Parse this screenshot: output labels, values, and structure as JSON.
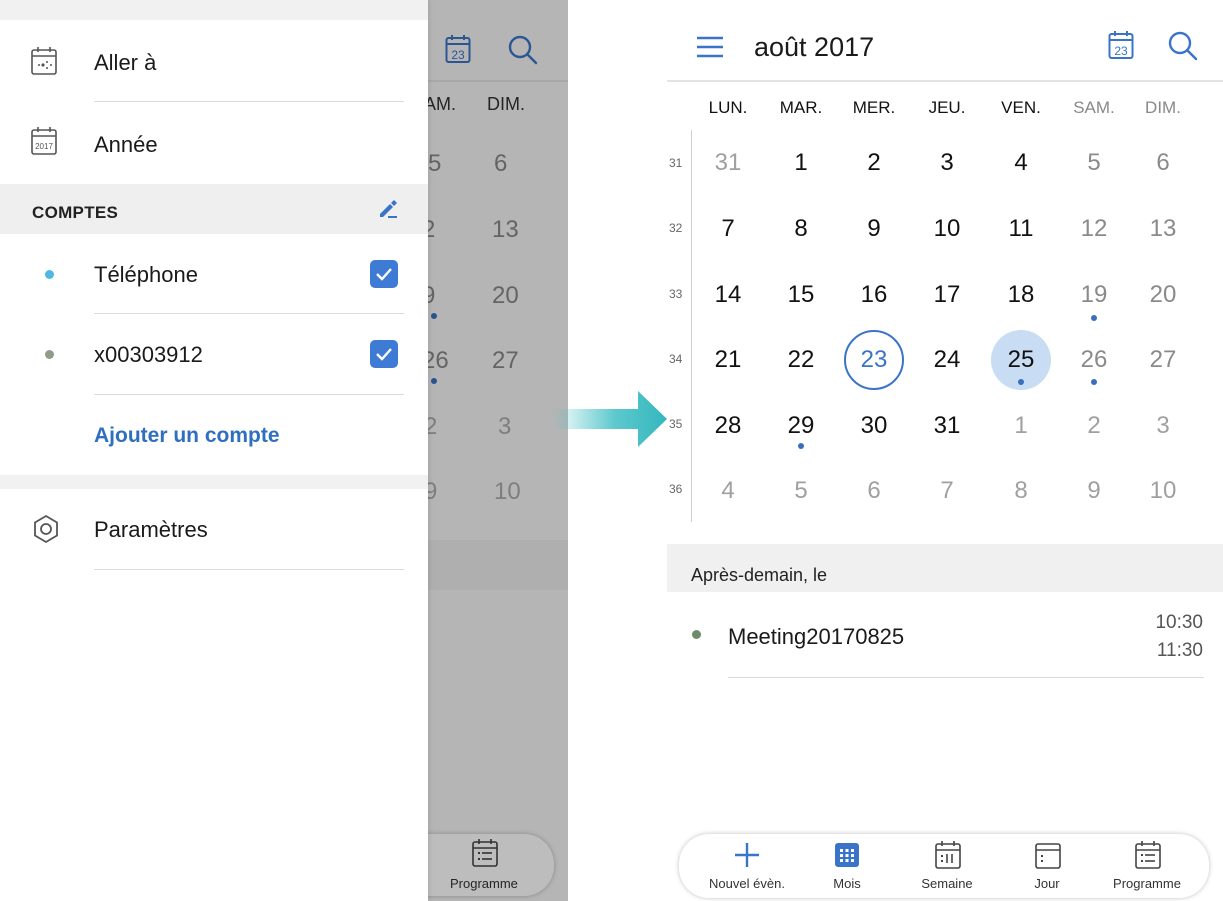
{
  "left": {
    "menu": {
      "goto": "Aller à",
      "year": "Année",
      "year_icon_text": "2017",
      "accounts_header": "COMPTES",
      "accounts": [
        {
          "name": "Téléphone",
          "color": "#4fb8e0",
          "checked": true
        },
        {
          "name": "x00303912",
          "color": "#8e9c88",
          "checked": true
        }
      ],
      "add_account": "Ajouter un compte",
      "settings": "Paramètres"
    },
    "background_calendar": {
      "today_icon_text": "23",
      "weekday_headers": [
        "AM.",
        "DIM."
      ],
      "rows": [
        [
          "5",
          "6"
        ],
        [
          "2",
          "13"
        ],
        [
          "9",
          "20"
        ],
        [
          "26",
          "27"
        ],
        [
          "2",
          "3"
        ],
        [
          "9",
          "10"
        ]
      ],
      "bottom_label": "Programme"
    }
  },
  "right": {
    "header": {
      "month": "août 2017",
      "today_icon_text": "23"
    },
    "weekdays": [
      "LUN.",
      "MAR.",
      "MER.",
      "JEU.",
      "VEN.",
      "SAM.",
      "DIM."
    ],
    "weeks": [
      {
        "no": "31",
        "days": [
          "31",
          "1",
          "2",
          "3",
          "4",
          "5",
          "6"
        ]
      },
      {
        "no": "32",
        "days": [
          "7",
          "8",
          "9",
          "10",
          "11",
          "12",
          "13"
        ]
      },
      {
        "no": "33",
        "days": [
          "14",
          "15",
          "16",
          "17",
          "18",
          "19",
          "20"
        ]
      },
      {
        "no": "34",
        "days": [
          "21",
          "22",
          "23",
          "24",
          "25",
          "26",
          "27"
        ]
      },
      {
        "no": "35",
        "days": [
          "28",
          "29",
          "30",
          "31",
          "1",
          "2",
          "3"
        ]
      },
      {
        "no": "36",
        "days": [
          "4",
          "5",
          "6",
          "7",
          "8",
          "9",
          "10"
        ]
      }
    ],
    "today": "23",
    "selected": "25",
    "agenda": {
      "title": "Après-demain, le",
      "event": {
        "name": "Meeting20170825",
        "start": "10:30",
        "end": "11:30",
        "color": "#6e8c6a"
      }
    },
    "bottom_nav": [
      {
        "label": "Nouvel évèn.",
        "icon": "plus-icon"
      },
      {
        "label": "Mois",
        "icon": "month-icon"
      },
      {
        "label": "Semaine",
        "icon": "week-icon"
      },
      {
        "label": "Jour",
        "icon": "day-icon"
      },
      {
        "label": "Programme",
        "icon": "agenda-icon"
      }
    ]
  },
  "colors": {
    "accent": "#3a74c8",
    "arrow": "#3fbfc4"
  }
}
